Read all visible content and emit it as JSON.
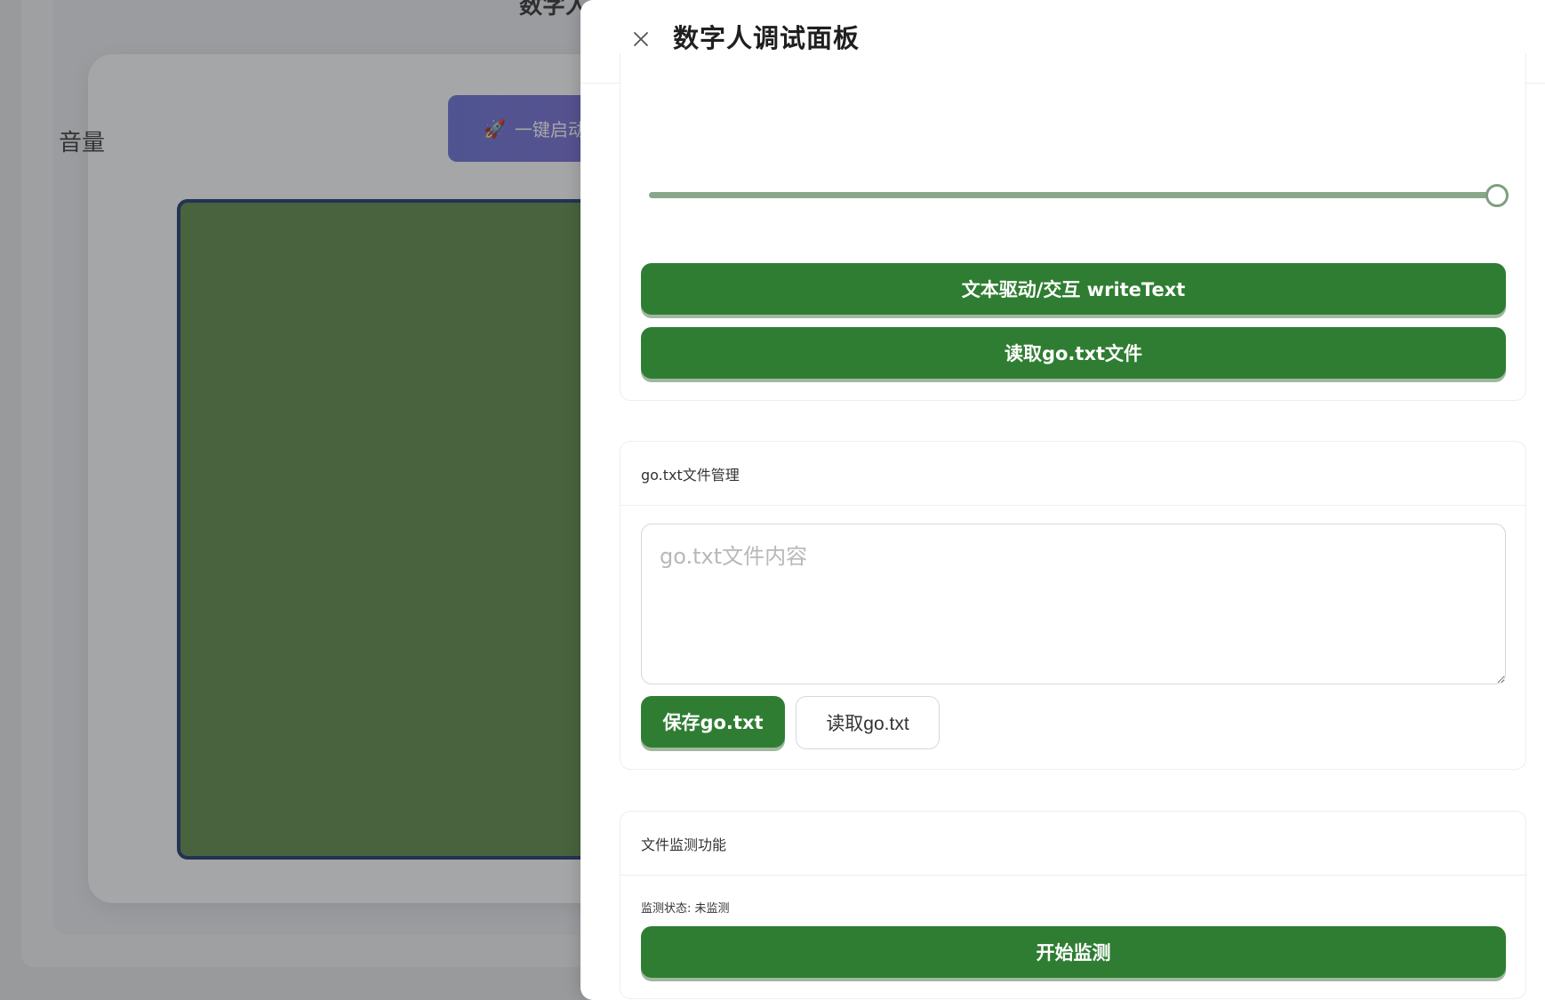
{
  "background": {
    "title_fragment": "数字人",
    "start_button": {
      "icon": "rocket-icon",
      "label": "一键启动"
    }
  },
  "drawer": {
    "title": "数字人调试面板",
    "close_icon": "close-icon"
  },
  "volume": {
    "label": "音量",
    "value": 1.0
  },
  "actions": {
    "write_text_label": "文本驱动/交互 writeText",
    "read_go_file_label": "读取go.txt文件"
  },
  "file_manager": {
    "header": "go.txt文件管理",
    "textarea_placeholder": "go.txt文件内容",
    "save_label": "保存go.txt",
    "read_label": "读取go.txt"
  },
  "monitor": {
    "header": "文件监测功能",
    "status_text": "监测状态: 未监测",
    "start_label": "开始监测"
  },
  "colors": {
    "primary_green": "#2f7d32",
    "slider": "#8aa68a",
    "overlay": "rgba(40,44,46,0.42)"
  }
}
